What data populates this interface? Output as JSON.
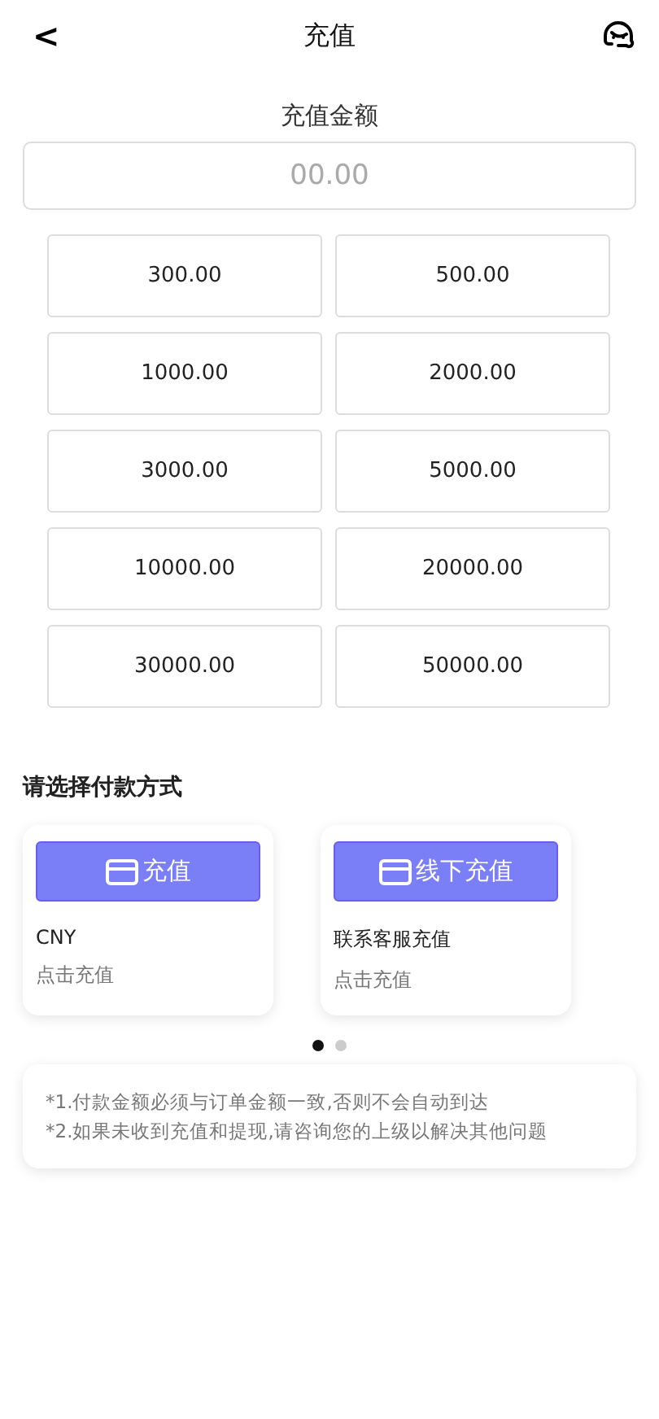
{
  "header": {
    "back": "<",
    "title": "充值"
  },
  "amount": {
    "label": "充值金额",
    "placeholder": "00.00"
  },
  "presets": [
    "300.00",
    "500.00",
    "1000.00",
    "2000.00",
    "3000.00",
    "5000.00",
    "10000.00",
    "20000.00",
    "30000.00",
    "50000.00"
  ],
  "payment": {
    "title": "请选择付款方式",
    "methods": [
      {
        "button": "充值",
        "name": "CNY",
        "hint": "点击充值"
      },
      {
        "button": "线下充值",
        "name": "联系客服充值",
        "hint": "点击充值"
      }
    ],
    "pager": [
      {
        "selected": true
      },
      {
        "selected": false
      }
    ]
  },
  "notes": [
    "*1.付款金额必须与订单金额一致,否则不会自动到达",
    "*2.如果未收到充值和提现,请咨询您的上级以解决其他问题"
  ]
}
